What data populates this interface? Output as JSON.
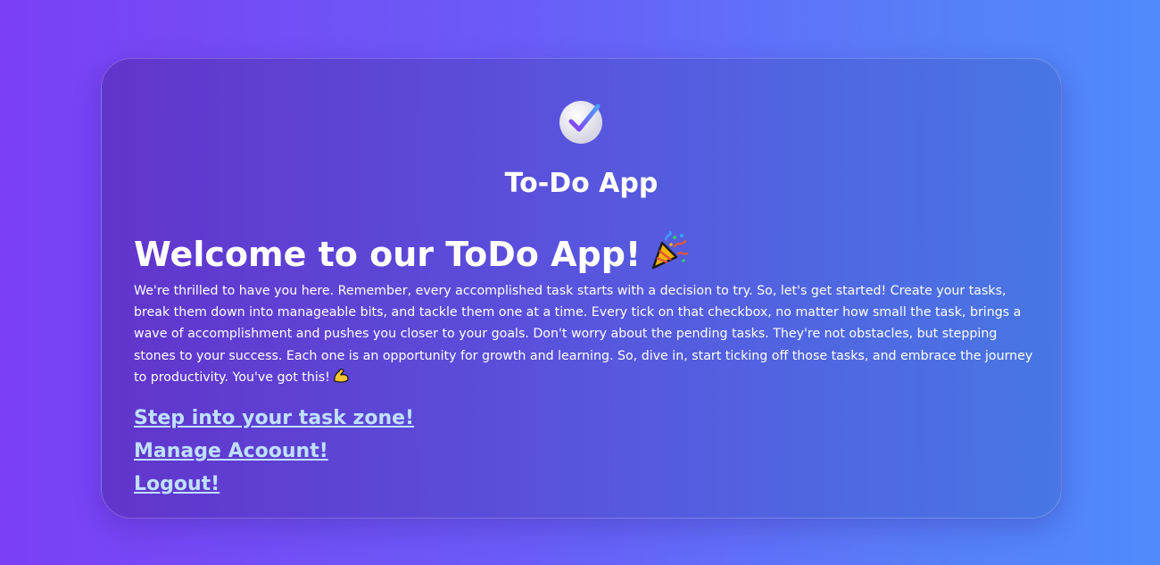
{
  "app": {
    "title": "To-Do App",
    "logo_icon": "check-circle-icon"
  },
  "welcome": {
    "heading": "Welcome to our ToDo App!",
    "heading_icon": "party-popper-icon",
    "message": "We're thrilled to have you here. Remember, every accomplished task starts with a decision to try. So, let's get started! Create your tasks, break them down into manageable bits, and tackle them one at a time. Every tick on that checkbox, no matter how small the task, brings a wave of accomplishment and pushes you closer to your goals. Don't worry about the pending tasks. They're not obstacles, but stepping stones to your success. Each one is an opportunity for growth and learning. So, dive in, start ticking off those tasks, and embrace the journey to productivity. You've got this!",
    "message_icon": "flexed-biceps-icon"
  },
  "links": {
    "task_zone": "Step into your task zone!",
    "manage_account": "Manage Acoount!",
    "logout": "Logout!"
  },
  "colors": {
    "background_start": "#7b3ff5",
    "background_end": "#4f8bfb",
    "link": "#bfe0ff",
    "text": "#ffffff"
  }
}
